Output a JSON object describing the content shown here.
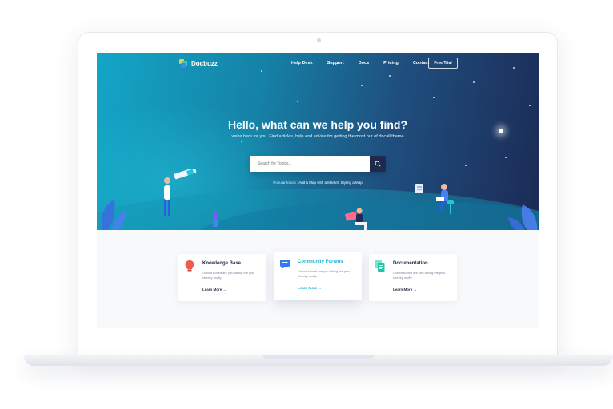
{
  "brand": {
    "name": "Docbuzz"
  },
  "nav": {
    "items": [
      "Help Desk",
      "Support",
      "Docs",
      "Pricing",
      "Contact"
    ],
    "cta_label": "Free Trial"
  },
  "hero": {
    "title": "Hello, what can we help you find?",
    "subtitle": "we're here for you. Find articles, help and advice for getting the most our of docall theme",
    "search_placeholder": "Search for Topics...",
    "popular_label": "Popular topics :",
    "popular_links": "Add a Map with a Market, Styling a Map"
  },
  "cards": [
    {
      "title": "Knowledge Base",
      "desc": "Oxford boneit are you taking the piss cheeky muffy.",
      "link": "Learn More →",
      "icon": "lightbulb-icon",
      "color": "#ef5b4e"
    },
    {
      "title": "Community Forums",
      "desc": "Oxford boneit are you taking the piss cheeky muffy.",
      "link": "Learn More →",
      "icon": "chat-bubble-icon",
      "color": "#2f7bf5"
    },
    {
      "title": "Documentation",
      "desc": "Oxford boneit are you taking the piss cheeky muffy.",
      "link": "Learn More →",
      "icon": "documents-icon",
      "color": "#1fc6a8"
    }
  ],
  "colors": {
    "hero_start": "#13a6c6",
    "hero_end": "#1c2a55",
    "accent": "#1ab0d6",
    "search_button": "#1e2a4c"
  }
}
